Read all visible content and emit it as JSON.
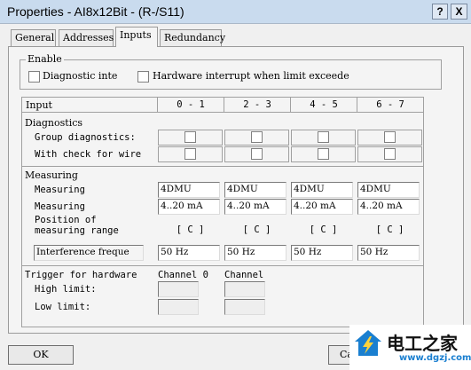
{
  "window": {
    "title": "Properties - AI8x12Bit - (R-/S11)",
    "help_glyph": "?",
    "close_glyph": "X"
  },
  "tabs": [
    {
      "label": "General"
    },
    {
      "label": "Addresses"
    },
    {
      "label": "Inputs",
      "active": true
    },
    {
      "label": "Redundancy"
    }
  ],
  "enable": {
    "legend": "Enable",
    "diagnostic_interrupt": {
      "label": "Diagnostic inte",
      "checked": false
    },
    "hardware_interrupt": {
      "label": "Hardware interrupt when limit exceede",
      "checked": false
    }
  },
  "table": {
    "input_header": "Input",
    "channels": [
      "0 - 1",
      "2 - 3",
      "4 - 5",
      "6 - 7"
    ],
    "diagnostics": {
      "heading": "Diagnostics",
      "group_diagnostics": {
        "label": "Group diagnostics:",
        "checked": [
          false,
          false,
          false,
          false
        ]
      },
      "wire_check": {
        "label": "With check for wire",
        "checked": [
          false,
          false,
          false,
          false
        ]
      }
    },
    "measuring": {
      "heading": "Measuring",
      "type": {
        "label": "Measuring",
        "values": [
          "4DMU",
          "4DMU",
          "4DMU",
          "4DMU"
        ]
      },
      "range": {
        "label": "Measuring",
        "values": [
          "4..20 mA",
          "4..20 mA",
          "4..20 mA",
          "4..20 mA"
        ]
      },
      "range_module_position": {
        "label_line1": "Position of",
        "label_line2": "measuring range",
        "values": [
          "[ C ]",
          "[ C ]",
          "[ C ]",
          "[ C ]"
        ]
      },
      "interference": {
        "label": "Interference freque",
        "values": [
          "50 Hz",
          "50 Hz",
          "50 Hz",
          "50 Hz"
        ]
      }
    },
    "trigger": {
      "heading": "Trigger for hardware",
      "channel_labels": [
        "Channel 0",
        "Channel"
      ],
      "high_limit_label": "High limit:",
      "low_limit_label": "Low limit:"
    }
  },
  "buttons": {
    "ok": "OK",
    "cancel": "Ca"
  },
  "watermark": {
    "logo_text": "电工之家",
    "url": "www.dgzj.com",
    "accent": "#1a7fd0"
  }
}
